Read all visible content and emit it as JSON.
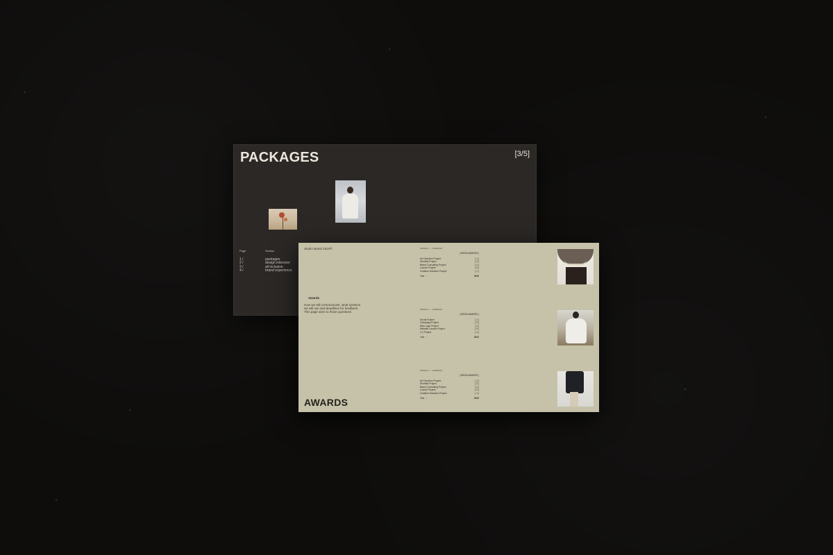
{
  "packages_slide": {
    "title": "PACKAGES",
    "counter": "[3/5]",
    "table": {
      "page_header": "Page",
      "section_header": "Section",
      "page_numbers": [
        "1   /",
        "2   /",
        "3   /",
        "4   /"
      ],
      "sections": [
        "packages",
        "design intensive",
        "all inclusive",
        "brand experience"
      ]
    }
  },
  "awards_slide": {
    "studio": "Studio Brand 2024®",
    "awards_label": "Awards",
    "description": "How we will communicate, what systems we will use and deadlines for feedback. This page aims to those questions",
    "title": "AWARDS",
    "groups": [
      {
        "kicker": "PROJECT  →  CAMPAIGN",
        "header": "[ MEDIA AWARDS ]",
        "rows": [
          {
            "name": "Art Direction Project",
            "count": "[ 1 ]"
          },
          {
            "name": "Shortlist Project",
            "count": "[ 3 ]"
          },
          {
            "name": "Brand Consulting Project",
            "count": "[ 2 ]"
          },
          {
            "name": "Launch Project",
            "count": "[ 5 ]"
          },
          {
            "name": "Creative Direction Project",
            "count": "[ 1 ]"
          }
        ],
        "footer_label": "Year  →",
        "year": "2020"
      },
      {
        "kicker": "PROJECT  →  CAMPAIGN",
        "header": "[ MEDIA AWARDS ]",
        "rows": [
          {
            "name": "Social Project",
            "count": "[ 1 ]"
          },
          {
            "name": "Campaign Project",
            "count": "[ 3 ]"
          },
          {
            "name": "New Logo Project",
            "count": "[ 2 ]"
          },
          {
            "name": "Website Launch Project",
            "count": "[ 5 ]"
          },
          {
            "name": "1:1 Project",
            "count": "[ 1 ]"
          }
        ],
        "footer_label": "Year  →",
        "year": "2021"
      },
      {
        "kicker": "PROJECT  →  CAMPAIGN",
        "header": "[ MEDIA AWARDS ]",
        "rows": [
          {
            "name": "Art Direction Project",
            "count": "[ 1 ]"
          },
          {
            "name": "Shortlist Project",
            "count": "[ 3 ]"
          },
          {
            "name": "Brand Consulting Project",
            "count": "[ 2 ]"
          },
          {
            "name": "Launch Project",
            "count": "[ 5 ]"
          },
          {
            "name": "Creative Direction Project",
            "count": "[ 1 ]"
          }
        ],
        "footer_label": "Year  →",
        "year": "2022"
      }
    ]
  },
  "colors": {
    "background": "#0e0d0c",
    "dark_slide": "#2b2826",
    "light_slide": "#c6c2a9"
  }
}
